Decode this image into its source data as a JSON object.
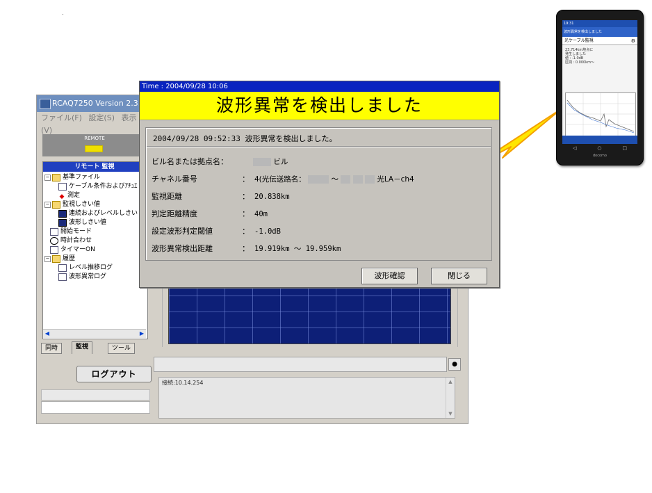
{
  "app": {
    "title": "RCAQ7250 Version 2.3.",
    "menu": [
      "ファイル(F)",
      "設定(S)",
      "表示(V)"
    ],
    "remote_label": "REMOTE",
    "tree_header": "リモート 監視",
    "tree_items": [
      "基準ファイル",
      "ケーブル条件およびｱﾁｭｴ",
      "測定",
      "監視しきい値",
      "連続およびレベルしきい",
      "波形しきい値",
      "開始モード",
      "時計合わせ",
      "タイマーON",
      "履歴",
      "レベル推移ログ",
      "波形異常ログ"
    ],
    "tabs": [
      "同時",
      "監視",
      "ツール"
    ],
    "logout_label": "ログアウト",
    "log_text": "接続:10.14.254",
    "dot_button": "●"
  },
  "dialog": {
    "titlebar": "Time : 2004/09/28 10:06",
    "heading": "波形異常を検出しました",
    "message": "2004/09/28 09:52:33 波形異常を検出しました。",
    "rows": [
      {
        "label": "ビル名または拠点名：",
        "colon": "",
        "value": "ビル"
      },
      {
        "label": "チャネル番号",
        "colon": "：",
        "value_prefix": "4(光伝送路名：",
        "value_sep": "〜",
        "value_suffix": "光LA－ch4"
      },
      {
        "label": "監視距離",
        "colon": "：",
        "value": "20.838km"
      },
      {
        "label": "判定距離精度",
        "colon": "：",
        "value": "40m"
      },
      {
        "label": "設定波形判定閾値",
        "colon": "：",
        "value": "-1.0dB"
      },
      {
        "label": "波形異常検出距離",
        "colon": "：",
        "value": "19.919km 〜 19.959km"
      }
    ],
    "buttons": {
      "confirm": "波形確認",
      "close": "閉じる"
    }
  },
  "phone": {
    "status": "19:31",
    "notification": "波形異常を検出しました",
    "appbar_title": "光ケーブル監視",
    "body_text": "23.714km地点に\n発生しました\n値 : -1.0dB\n区間 : 0.000km〜",
    "brand": "docomo"
  },
  "colors": {
    "banner": "#ffff00",
    "titlebar": "#0a24c0",
    "bolt_fill": "#ffe600",
    "bolt_stroke": "#f4a000",
    "graph_bg": "#0d1f77"
  }
}
